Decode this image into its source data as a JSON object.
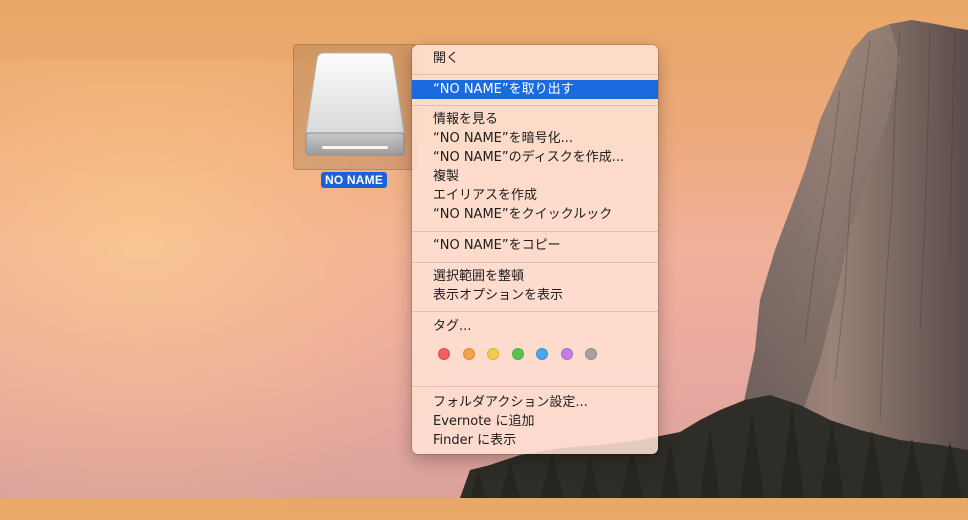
{
  "desktop": {
    "drive_name": "NO NAME"
  },
  "menu": {
    "items": {
      "open": "開く",
      "eject": "“NO NAME”を取り出す",
      "get_info": "情報を見る",
      "encrypt": "“NO NAME”を暗号化...",
      "burn": "“NO NAME”のディスクを作成...",
      "duplicate": "複製",
      "make_alias": "エイリアスを作成",
      "quick_look": "“NO NAME”をクイックルック",
      "copy": "“NO NAME”をコピー",
      "clean_up": "選択範囲を整頓",
      "view_options": "表示オプションを表示",
      "tags": "タグ...",
      "folder_actions": "フォルダアクション設定...",
      "evernote": "Evernote に追加",
      "finder": "Finder に表示"
    },
    "highlighted": "eject",
    "tag_colors": [
      {
        "name": "red-tag",
        "color": "#f25f5c"
      },
      {
        "name": "orange-tag",
        "color": "#f5a04a"
      },
      {
        "name": "yellow-tag",
        "color": "#f4cc45"
      },
      {
        "name": "green-tag",
        "color": "#5dc14f"
      },
      {
        "name": "blue-tag",
        "color": "#46a8f0"
      },
      {
        "name": "purple-tag",
        "color": "#c57ee0"
      },
      {
        "name": "gray-tag",
        "color": "#a3a3a3"
      }
    ]
  }
}
